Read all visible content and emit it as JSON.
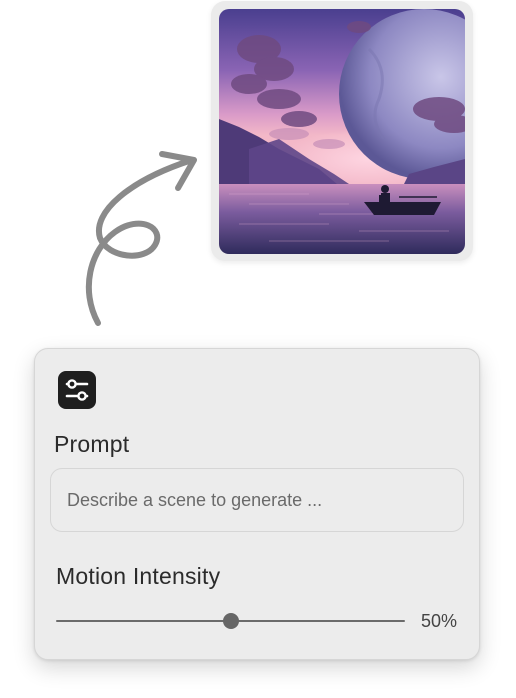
{
  "image": {
    "description_icon": "generated-image"
  },
  "settings": {
    "icon": "sliders-icon",
    "prompt_label": "Prompt",
    "prompt_placeholder": "Describe a scene to generate ...",
    "prompt_value": "",
    "motion_label": "Motion Intensity",
    "motion_value": 0.5,
    "motion_value_text": "50%"
  },
  "colors": {
    "panel_bg": "#ececec",
    "icon_bg": "#1f1f1f",
    "arrow": "#8a8a8a",
    "slider": "#666666"
  }
}
